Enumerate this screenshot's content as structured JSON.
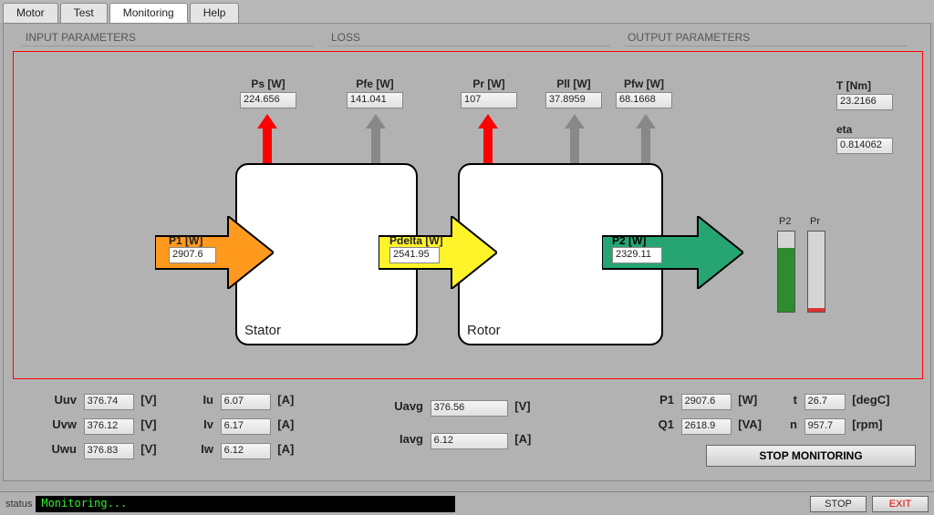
{
  "tabs": {
    "motor": "Motor",
    "test": "Test",
    "monitoring": "Monitoring",
    "help": "Help"
  },
  "sections": {
    "input": "INPUT PARAMETERS",
    "loss": "LOSS",
    "output": "OUTPUT PARAMETERS"
  },
  "loss": {
    "ps": {
      "label": "Ps [W]",
      "value": "224.656"
    },
    "pfe": {
      "label": "Pfe [W]",
      "value": "141.041"
    },
    "pr": {
      "label": "Pr [W]",
      "value": "107"
    },
    "pll": {
      "label": "Pll [W]",
      "value": "37.8959"
    },
    "pfw": {
      "label": "Pfw [W]",
      "value": "68.1668"
    }
  },
  "flow": {
    "p1": {
      "label": "P1 [W]",
      "value": "2907.6"
    },
    "pdelta": {
      "label": "Pdelta [W]",
      "value": "2541.95"
    },
    "p2": {
      "label": "P2 [W]",
      "value": "2329.11"
    }
  },
  "blocks": {
    "stator": "Stator",
    "rotor": "Rotor"
  },
  "output": {
    "t": {
      "label": "T [Nm]",
      "value": "23.2166"
    },
    "eta": {
      "label": "eta",
      "value": "0.814062"
    }
  },
  "bars": {
    "p2": "P2",
    "pr": "Pr"
  },
  "meas": {
    "uuv": {
      "label": "Uuv",
      "value": "376.74",
      "unit": "[V]"
    },
    "uvw": {
      "label": "Uvw",
      "value": "376.12",
      "unit": "[V]"
    },
    "uwu": {
      "label": "Uwu",
      "value": "376.83",
      "unit": "[V]"
    },
    "iu": {
      "label": "Iu",
      "value": "6.07",
      "unit": "[A]"
    },
    "iv": {
      "label": "Iv",
      "value": "6.17",
      "unit": "[A]"
    },
    "iw": {
      "label": "Iw",
      "value": "6.12",
      "unit": "[A]"
    },
    "uavg": {
      "label": "Uavg",
      "value": "376.56",
      "unit": "[V]"
    },
    "iavg": {
      "label": "Iavg",
      "value": "6.12",
      "unit": "[A]"
    },
    "p1": {
      "label": "P1",
      "value": "2907.6",
      "unit": "[W]"
    },
    "q1": {
      "label": "Q1",
      "value": "2618.9",
      "unit": "[VA]"
    },
    "t": {
      "label": "t",
      "value": "26.7",
      "unit": "[degC]"
    },
    "n": {
      "label": "n",
      "value": "957.7",
      "unit": "[rpm]"
    }
  },
  "buttons": {
    "stop_mon": "STOP MONITORING",
    "stop": "STOP",
    "exit": "EXIT"
  },
  "status": {
    "label": "status",
    "text": "Monitoring..."
  }
}
